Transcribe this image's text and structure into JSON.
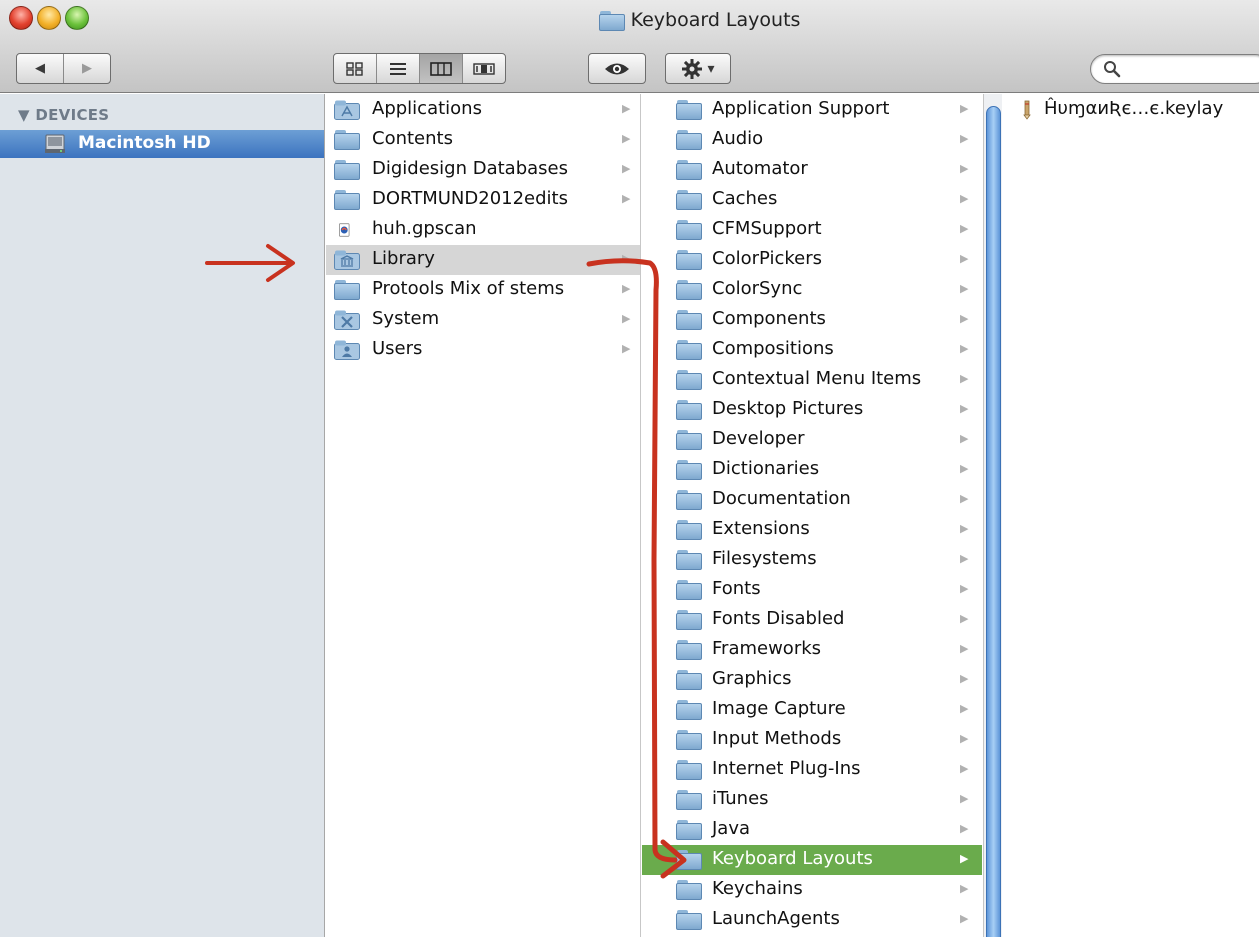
{
  "window": {
    "title": "Keyboard Layouts"
  },
  "toolbar": {
    "back_glyph": "◀",
    "forward_glyph": "▶",
    "view_icons": [
      "icon-view-icon",
      "list-view-icon",
      "column-view-icon",
      "coverflow-view-icon"
    ],
    "active_view": "column-view",
    "action_caret": "▾"
  },
  "search": {
    "placeholder": ""
  },
  "sidebar": {
    "header": "▼ DEVICES",
    "items": [
      {
        "label": "Macintosh HD",
        "icon": "hard-drive-icon",
        "selected": true
      }
    ]
  },
  "column1": {
    "items": [
      {
        "label": "Applications",
        "icon": "applications-folder-icon",
        "has_children": true
      },
      {
        "label": "Contents",
        "icon": "folder-icon",
        "has_children": true
      },
      {
        "label": "Digidesign Databases",
        "icon": "folder-icon",
        "has_children": true
      },
      {
        "label": "DORTMUND2012edits",
        "icon": "folder-icon",
        "has_children": true
      },
      {
        "label": "huh.gpscan",
        "icon": "gpscan-file-icon",
        "has_children": false
      },
      {
        "label": "Library",
        "icon": "library-folder-icon",
        "has_children": true,
        "selected": true
      },
      {
        "label": "Protools Mix of stems",
        "icon": "folder-icon",
        "has_children": true
      },
      {
        "label": "System",
        "icon": "system-folder-icon",
        "has_children": true
      },
      {
        "label": "Users",
        "icon": "users-folder-icon",
        "has_children": true
      }
    ]
  },
  "column2": {
    "items": [
      {
        "label": "Application Support"
      },
      {
        "label": "Audio"
      },
      {
        "label": "Automator"
      },
      {
        "label": "Caches"
      },
      {
        "label": "CFMSupport"
      },
      {
        "label": "ColorPickers"
      },
      {
        "label": "ColorSync"
      },
      {
        "label": "Components"
      },
      {
        "label": "Compositions"
      },
      {
        "label": "Contextual Menu Items"
      },
      {
        "label": "Desktop Pictures"
      },
      {
        "label": "Developer"
      },
      {
        "label": "Dictionaries"
      },
      {
        "label": "Documentation"
      },
      {
        "label": "Extensions"
      },
      {
        "label": "Filesystems"
      },
      {
        "label": "Fonts"
      },
      {
        "label": "Fonts Disabled"
      },
      {
        "label": "Frameworks"
      },
      {
        "label": "Graphics"
      },
      {
        "label": "Image Capture"
      },
      {
        "label": "Input Methods"
      },
      {
        "label": "Internet Plug-Ins"
      },
      {
        "label": "iTunes"
      },
      {
        "label": "Java"
      },
      {
        "label": "Keyboard Layouts",
        "selected": true
      },
      {
        "label": "Keychains"
      },
      {
        "label": "LaunchAgents"
      }
    ]
  },
  "column3": {
    "items": [
      {
        "label": "ĤυɱαиƦє…є.keylay",
        "icon": "keylayout-file-icon"
      }
    ]
  },
  "colors": {
    "sidebar_bg": "#dee4ea",
    "sidebar_selection": "#3b73bf",
    "path_selection_gray": "#d6d6d6",
    "current_selection_green": "#6aab4c",
    "annotation_red": "#c8321f"
  }
}
